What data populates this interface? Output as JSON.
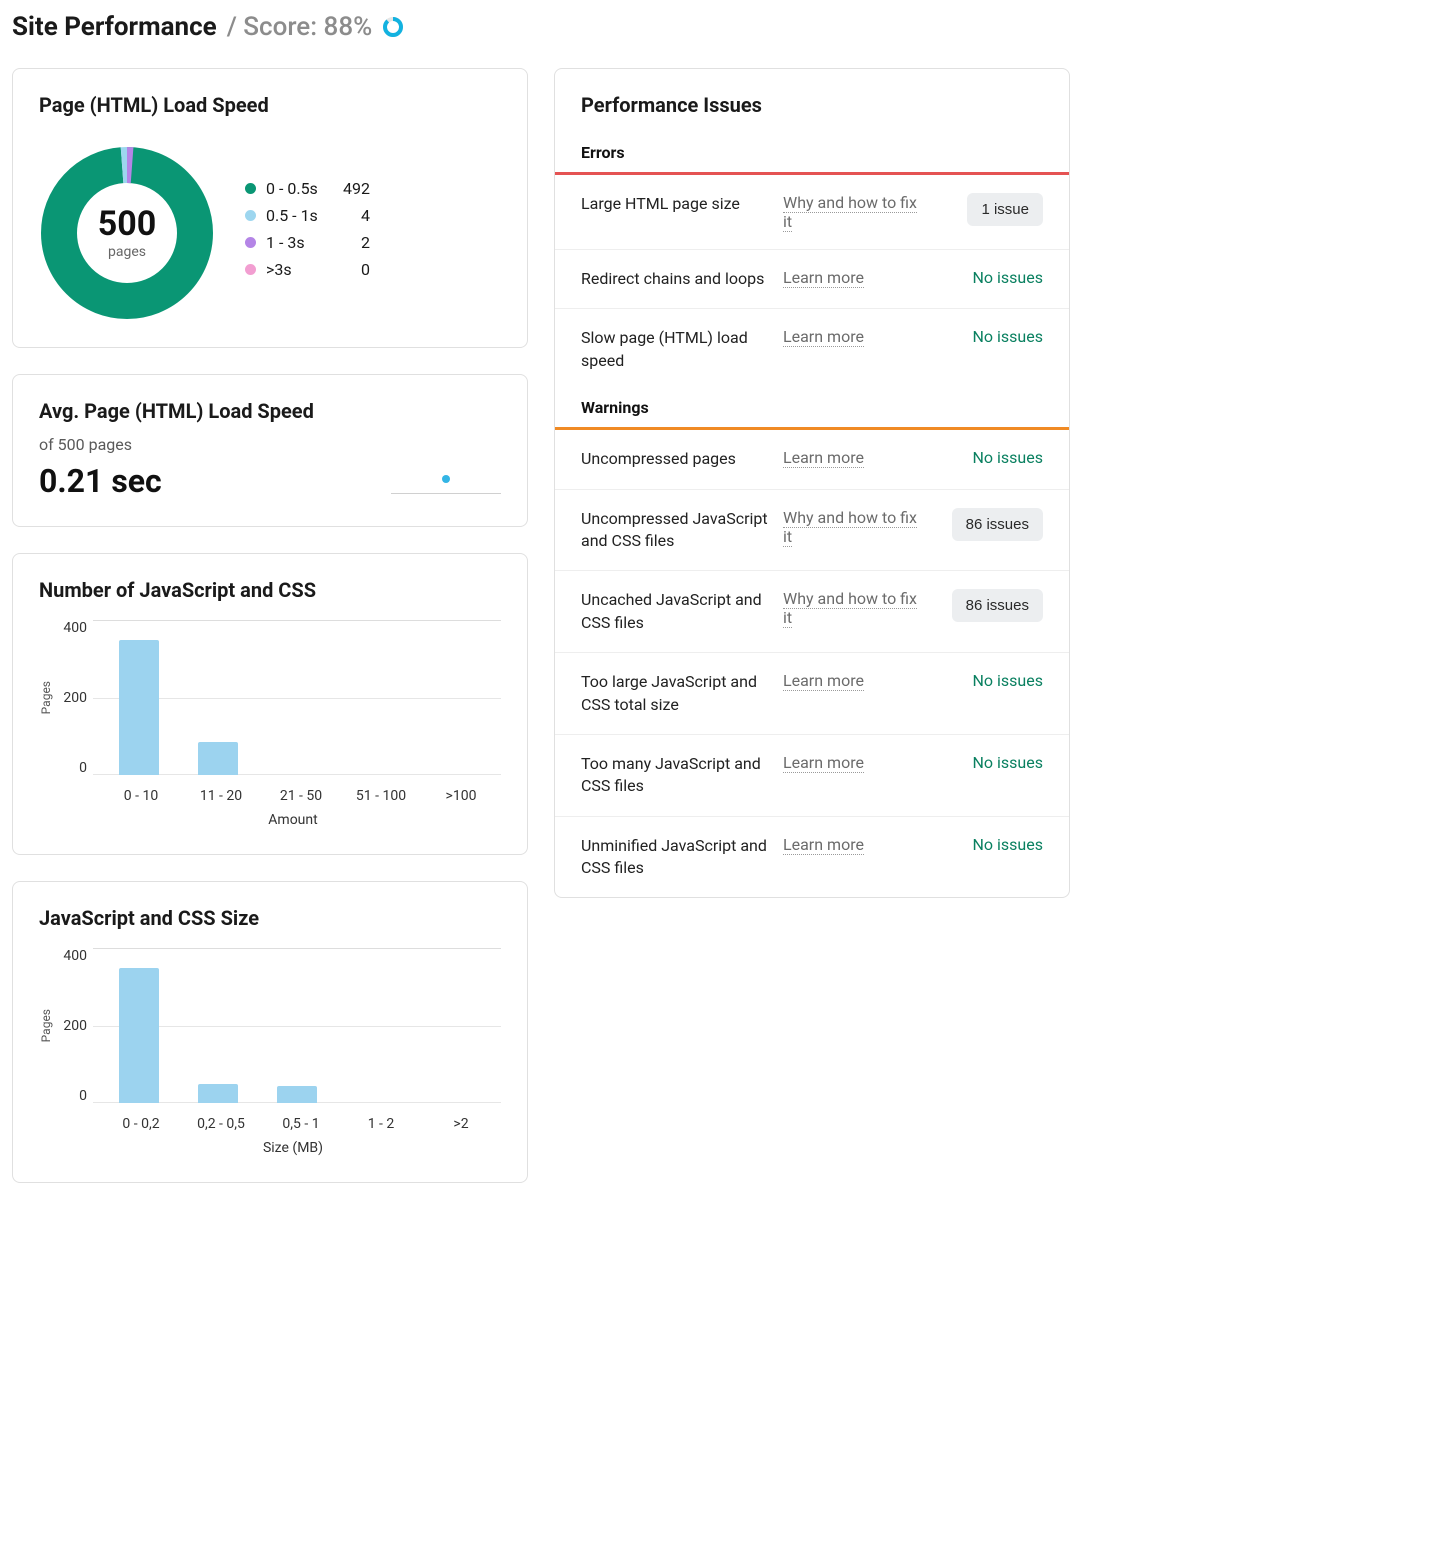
{
  "header": {
    "title": "Site Performance",
    "score_label": "/ Score: 88%",
    "score_percent": 88
  },
  "loadSpeed": {
    "title": "Page (HTML) Load Speed",
    "totalPages": "500",
    "pagesLabel": "pages",
    "segments": [
      {
        "label": "0 - 0.5s",
        "value": 492,
        "color": "#0a9674"
      },
      {
        "label": "0.5 - 1s",
        "value": 4,
        "color": "#9dd6ef"
      },
      {
        "label": "1 - 3s",
        "value": 2,
        "color": "#b485e6"
      },
      {
        "label": ">3s",
        "value": 0,
        "color": "#f29ed1"
      }
    ]
  },
  "avgLoad": {
    "title": "Avg. Page (HTML) Load Speed",
    "subtitle": "of 500 pages",
    "value": "0.21 sec"
  },
  "jsCssCount": {
    "title": "Number of JavaScript and CSS"
  },
  "jsCssSize": {
    "title": "JavaScript and CSS Size"
  },
  "performanceIssues": {
    "title": "Performance Issues",
    "errors_label": "Errors",
    "warnings_label": "Warnings",
    "learn_more": "Learn more",
    "why_fix": "Why and how to fix it",
    "no_issues": "No issues",
    "errors": [
      {
        "name": "Large HTML page size",
        "link": "why",
        "status": "1 issue"
      },
      {
        "name": "Redirect chains and loops",
        "link": "learn",
        "status": "none"
      },
      {
        "name": "Slow page (HTML) load speed",
        "link": "learn",
        "status": "none"
      }
    ],
    "warnings": [
      {
        "name": "Uncompressed pages",
        "link": "learn",
        "status": "none"
      },
      {
        "name": "Uncompressed JavaScript and CSS files",
        "link": "why",
        "status": "86 issues"
      },
      {
        "name": "Uncached JavaScript and CSS files",
        "link": "why",
        "status": "86 issues"
      },
      {
        "name": "Too large JavaScript and CSS total size",
        "link": "learn",
        "status": "none"
      },
      {
        "name": "Too many JavaScript and CSS files",
        "link": "learn",
        "status": "none"
      },
      {
        "name": "Unminified JavaScript and CSS files",
        "link": "learn",
        "status": "none"
      }
    ]
  },
  "chart_data": [
    {
      "type": "donut",
      "title": "Page (HTML) Load Speed",
      "total": 500,
      "series": [
        {
          "name": "0 - 0.5s",
          "value": 492
        },
        {
          "name": "0.5 - 1s",
          "value": 4
        },
        {
          "name": "1 - 3s",
          "value": 2
        },
        {
          "name": ">3s",
          "value": 0
        }
      ]
    },
    {
      "type": "bar",
      "title": "Number of JavaScript and CSS",
      "xlabel": "Amount",
      "ylabel": "Pages",
      "ylim": [
        0,
        400
      ],
      "yticks": [
        0,
        200,
        400
      ],
      "categories": [
        "0 - 10",
        "11 - 20",
        "21 - 50",
        "51 - 100",
        ">100"
      ],
      "values": [
        350,
        85,
        0,
        0,
        0
      ]
    },
    {
      "type": "bar",
      "title": "JavaScript and CSS Size",
      "xlabel": "Size (MB)",
      "ylabel": "Pages",
      "ylim": [
        0,
        400
      ],
      "yticks": [
        0,
        200,
        400
      ],
      "categories": [
        "0 - 0,2",
        "0,2 - 0,5",
        "0,5 - 1",
        "1 - 2",
        ">2"
      ],
      "values": [
        350,
        50,
        45,
        0,
        0
      ]
    }
  ]
}
